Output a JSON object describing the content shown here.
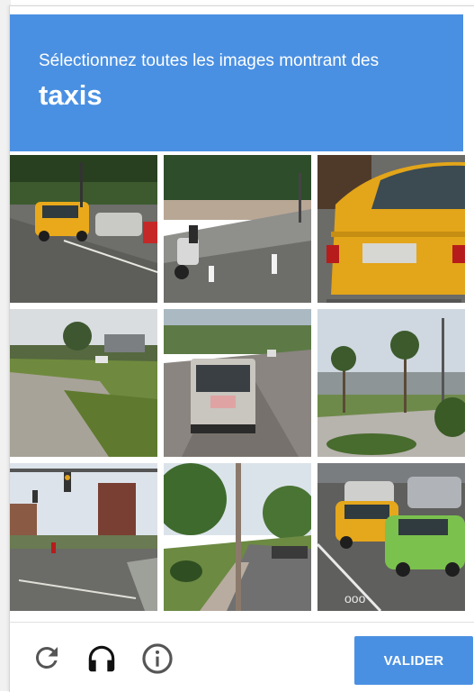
{
  "challenge": {
    "instruction": "Sélectionnez toutes les images montrant des",
    "target": "taxis",
    "header_color": "#4a90e2"
  },
  "tiles": [
    {
      "row": 1,
      "col": 1,
      "scene": "street with yellow taxi and parked cars"
    },
    {
      "row": 1,
      "col": 2,
      "scene": "scooter on sidewalk"
    },
    {
      "row": 1,
      "col": 3,
      "scene": "rear of yellow taxi"
    },
    {
      "row": 2,
      "col": 1,
      "scene": "empty road and grass"
    },
    {
      "row": 2,
      "col": 2,
      "scene": "bus on highway"
    },
    {
      "row": 2,
      "col": 3,
      "scene": "palm trees and parking lot"
    },
    {
      "row": 3,
      "col": 1,
      "scene": "intersection with traffic light"
    },
    {
      "row": 3,
      "col": 2,
      "scene": "tree lined road with pole"
    },
    {
      "row": 3,
      "col": 3,
      "scene": "yellow and green taxis in traffic"
    }
  ],
  "footer": {
    "reload_icon": "reload-icon",
    "audio_icon": "headphones-icon",
    "info_icon": "info-icon",
    "verify_label": "VALIDER",
    "icon_color": "#555555",
    "button_color": "#4a90e2"
  }
}
